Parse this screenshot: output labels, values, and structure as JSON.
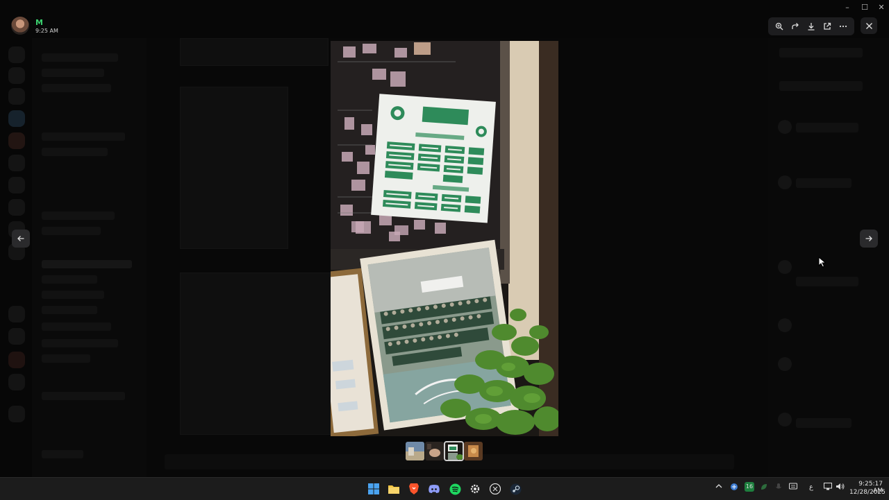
{
  "user": {
    "initial": "M",
    "time": "9:25 AM"
  },
  "backdrop": {
    "server_name": "",
    "channel_name": "",
    "window_title": ""
  },
  "viewer": {
    "toolbar": [
      {
        "name": "zoom-icon",
        "label": "Zoom"
      },
      {
        "name": "forward-icon",
        "label": "Forward"
      },
      {
        "name": "download-icon",
        "label": "Download"
      },
      {
        "name": "open-external-icon",
        "label": "Open in browser"
      },
      {
        "name": "more-icon",
        "label": "More"
      }
    ],
    "close": "Close",
    "thumbnails": 4,
    "active_thumbnail": 2
  },
  "taskbar": {
    "apps": [
      "windows-start-icon",
      "file-explorer-icon",
      "brave-icon",
      "discord-icon",
      "spotify-icon",
      "settings-icon",
      "github-icon",
      "steam-icon"
    ],
    "tray_badge": "16",
    "language": "ع",
    "clock_time": "9:25:17 AM",
    "clock_date": "12/28/2025"
  },
  "colors": {
    "accent_green": "#3bd16f",
    "toolbar_bg": "#1d1d1f",
    "sign_green": "#2e8b5a"
  }
}
